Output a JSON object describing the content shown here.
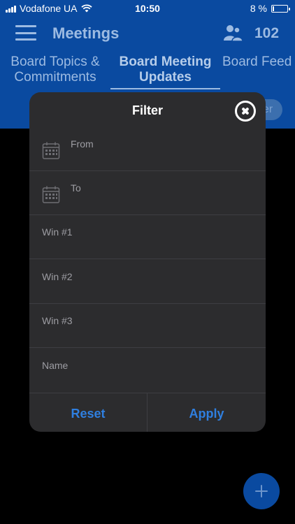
{
  "status_bar": {
    "carrier": "Vodafone UA",
    "time": "10:50",
    "battery_percent": "8 %",
    "battery_level": 0.08
  },
  "header": {
    "title": "Meetings",
    "user_count": "102",
    "tabs": [
      {
        "label": "Board Topics & Commitments",
        "selected": false
      },
      {
        "label": "Board Meeting Updates",
        "selected": true
      },
      {
        "label": "Board Feed",
        "selected": false
      }
    ],
    "filter_button_partial": "er"
  },
  "filter_dialog": {
    "title": "Filter",
    "fields": [
      {
        "label": "From",
        "icon": "calendar-icon"
      },
      {
        "label": "To",
        "icon": "calendar-icon"
      },
      {
        "label": "Win #1"
      },
      {
        "label": "Win #2"
      },
      {
        "label": "Win #3"
      },
      {
        "label": "Name"
      }
    ],
    "reset_label": "Reset",
    "apply_label": "Apply"
  },
  "colors": {
    "header_bg": "#0a4aa0",
    "dialog_bg": "#2c2c2e",
    "accent": "#2f7fe0"
  }
}
